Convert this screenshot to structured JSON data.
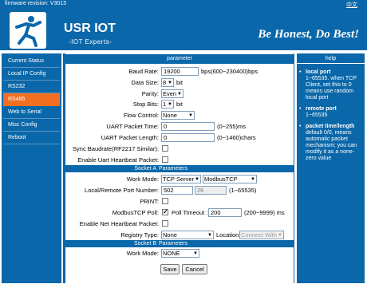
{
  "header": {
    "firmware_label": "firmware revision:  V3013",
    "lang_link": "中文",
    "brand": "USR IOT",
    "tagline": "-IOT Experts-",
    "slogan": "Be Honest, Do Best!"
  },
  "sidebar": {
    "items": [
      {
        "label": "Current Status",
        "active": false
      },
      {
        "label": "Local IP Config",
        "active": false
      },
      {
        "label": "RS232",
        "active": false
      },
      {
        "label": "RS485",
        "active": true
      },
      {
        "label": "Web to Serial",
        "active": false
      },
      {
        "label": "Misc Config",
        "active": false
      },
      {
        "label": "Reboot",
        "active": false
      }
    ]
  },
  "panel": {
    "title": "parameter",
    "baud_rate": {
      "label": "Baud Rate:",
      "value": "19200",
      "unit": "bps(600~230400)bps"
    },
    "data_size": {
      "label": "Data Size:",
      "value": "8",
      "unit": "bit"
    },
    "parity": {
      "label": "Parity:",
      "value": "Even"
    },
    "stop_bits": {
      "label": "Stop Bits:",
      "value": "1",
      "unit": "bit"
    },
    "flow_control": {
      "label": "Flow Control:",
      "value": "None"
    },
    "uart_packet_time": {
      "label": "UART Packet Time:",
      "value": "0",
      "unit": "(0~255)ms"
    },
    "uart_packet_length": {
      "label": "UART Packet Length:",
      "value": "0",
      "unit": "(0~1460)chars"
    },
    "sync_baudrate": {
      "label": "Sync Baudrate(RF2217 Similar):"
    },
    "uart_heartbeat": {
      "label": "Enable Uart Heartbeat Packet:"
    },
    "socket_a": {
      "section": "Socket A",
      "section_sub": "Parameters",
      "work_mode": {
        "label": "Work Mode:",
        "value": "TCP Server",
        "protocol": "ModbusTCP"
      },
      "port": {
        "label": "Local/Remote Port Number:",
        "local": "502",
        "remote": "26",
        "unit": "(1~65535)"
      },
      "print": {
        "label": "PRINT:"
      },
      "modbus_poll": {
        "label": "ModbusTCP Poll:",
        "timeout_label": "Poll Timeout :",
        "timeout_value": "200",
        "unit": "(200~9999) ms"
      },
      "net_heartbeat": {
        "label": "Enable Net Heartbeat Packet:"
      },
      "registry": {
        "label": "Registry Type:",
        "value": "None",
        "location_label": "Location",
        "location_value": "Connect With"
      }
    },
    "socket_b": {
      "section": "Socket B",
      "section_sub": "Parameters",
      "work_mode": {
        "label": "Work Mode:",
        "value": "NONE"
      }
    },
    "save_label": "Save",
    "cancel_label": "Cancel"
  },
  "help": {
    "title": "help",
    "items": [
      {
        "title": "local port",
        "text": "1~65535. when TCP Client, set this to 0 means use random local port"
      },
      {
        "title": "remote port",
        "text": "1~65535"
      },
      {
        "title": "packet time/length",
        "text": "default 0/0, means automatic packet mechanism; you can modify it as a none-zero value"
      }
    ]
  }
}
